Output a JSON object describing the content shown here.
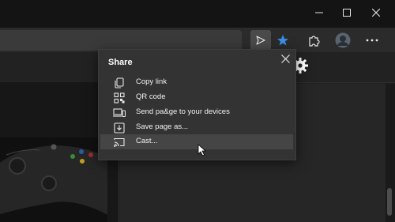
{
  "share_menu": {
    "title": "Share",
    "items": [
      {
        "label": "Copy link",
        "icon": "copy-icon"
      },
      {
        "label": "QR code",
        "icon": "qr-code-icon"
      },
      {
        "label": "Send pa&ge to your devices",
        "icon": "send-to-devices-icon"
      },
      {
        "label": "Save page as...",
        "icon": "save-icon"
      },
      {
        "label": "Cast...",
        "icon": "cast-icon",
        "hovered": true
      }
    ]
  },
  "toolbar": {
    "icons": [
      "share-icon",
      "favorites-star-icon",
      "extensions-icon",
      "profile-avatar",
      "more-options-icon"
    ],
    "accent": "#3b8ee6"
  },
  "window_controls": [
    "minimize-icon",
    "maximize-icon",
    "close-icon"
  ]
}
